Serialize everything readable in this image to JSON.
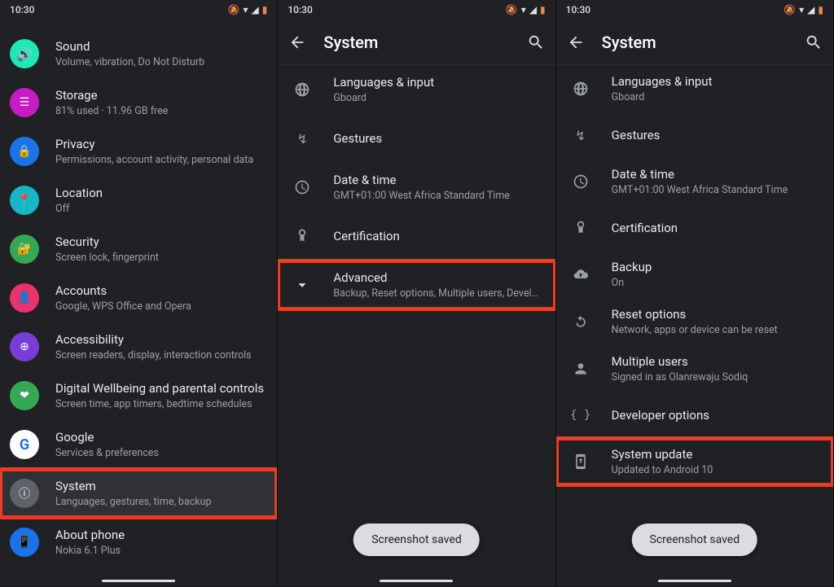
{
  "status": {
    "time": "10:30"
  },
  "s1": {
    "items": [
      {
        "title": "Sound",
        "sub": "Volume, vibration, Do Not Disturb",
        "color": "#1de9b6"
      },
      {
        "title": "Storage",
        "sub": "81% used · 11.96 GB free",
        "color": "#c51cc5"
      },
      {
        "title": "Privacy",
        "sub": "Permissions, account activity, personal data",
        "color": "#1a73e8"
      },
      {
        "title": "Location",
        "sub": "Off",
        "color": "#1de9b6"
      },
      {
        "title": "Security",
        "sub": "Screen lock, fingerprint",
        "color": "#34a853"
      },
      {
        "title": "Accounts",
        "sub": "Google, WPS Office and Opera",
        "color": "#ea336c"
      },
      {
        "title": "Accessibility",
        "sub": "Screen readers, display, interaction controls",
        "color": "#7a3cd6"
      },
      {
        "title": "Digital Wellbeing and parental controls",
        "sub": "Screen time, app timers, bedtime schedules",
        "color": "#34a853"
      },
      {
        "title": "Google",
        "sub": "Services & preferences",
        "color": "#1a73e8"
      },
      {
        "title": "System",
        "sub": "Languages, gestures, time, backup",
        "color": "#5f6368"
      },
      {
        "title": "About phone",
        "sub": "Nokia 6.1 Plus",
        "color": "#1a73e8"
      }
    ]
  },
  "s2": {
    "heading": "System",
    "items": [
      {
        "title": "Languages & input",
        "sub": "Gboard"
      },
      {
        "title": "Gestures",
        "sub": ""
      },
      {
        "title": "Date & time",
        "sub": "GMT+01:00 West Africa Standard Time"
      },
      {
        "title": "Certification",
        "sub": ""
      },
      {
        "title": "Advanced",
        "sub": "Backup, Reset options, Multiple users, Developer o.."
      }
    ],
    "snackbar": "Screenshot saved"
  },
  "s3": {
    "heading": "System",
    "items": [
      {
        "title": "Languages & input",
        "sub": "Gboard"
      },
      {
        "title": "Gestures",
        "sub": ""
      },
      {
        "title": "Date & time",
        "sub": "GMT+01:00 West Africa Standard Time"
      },
      {
        "title": "Certification",
        "sub": ""
      },
      {
        "title": "Backup",
        "sub": "On"
      },
      {
        "title": "Reset options",
        "sub": "Network, apps or device can be reset"
      },
      {
        "title": "Multiple users",
        "sub": "Signed in as Olanrewaju Sodiq"
      },
      {
        "title": "Developer options",
        "sub": ""
      },
      {
        "title": "System update",
        "sub": "Updated to Android 10"
      }
    ],
    "snackbar": "Screenshot saved"
  }
}
